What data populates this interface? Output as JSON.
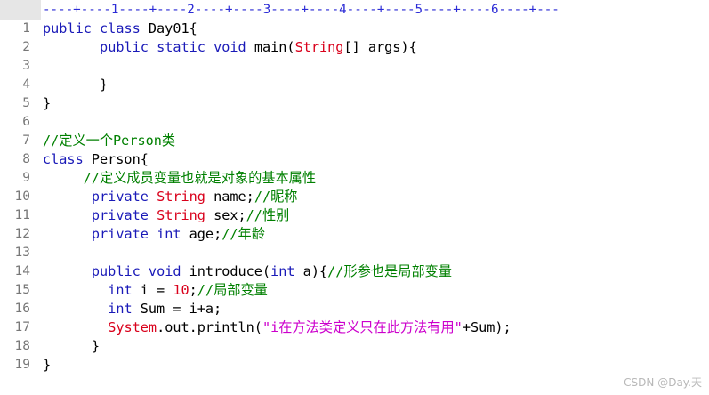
{
  "ruler": {
    "text": "----+----1----+----2----+----3----+----4----+----5----+----6----+---"
  },
  "colors": {
    "keyword": "#1a1ab8",
    "type": "#d9001b",
    "comment": "#008000",
    "string": "#cc00cc",
    "plain": "#000000",
    "line_number": "#777777"
  },
  "lines": [
    {
      "n": "1",
      "indent": 0,
      "tokens": [
        [
          "kw",
          "public"
        ],
        [
          "pl",
          " "
        ],
        [
          "kw",
          "class"
        ],
        [
          "pl",
          " Day01{"
        ]
      ]
    },
    {
      "n": "2",
      "indent": 7,
      "tokens": [
        [
          "kw",
          "public"
        ],
        [
          "pl",
          " "
        ],
        [
          "kw",
          "static"
        ],
        [
          "pl",
          " "
        ],
        [
          "kw",
          "void"
        ],
        [
          "pl",
          " main("
        ],
        [
          "ty",
          "String"
        ],
        [
          "pl",
          "[] args){"
        ]
      ]
    },
    {
      "n": "3",
      "indent": 0,
      "tokens": []
    },
    {
      "n": "4",
      "indent": 7,
      "tokens": [
        [
          "pl",
          "}"
        ]
      ]
    },
    {
      "n": "5",
      "indent": 0,
      "tokens": [
        [
          "pl",
          "}"
        ]
      ]
    },
    {
      "n": "6",
      "indent": 0,
      "tokens": []
    },
    {
      "n": "7",
      "indent": 0,
      "tokens": [
        [
          "cm",
          "//定义一个Person类"
        ]
      ]
    },
    {
      "n": "8",
      "indent": 0,
      "tokens": [
        [
          "kw",
          "class"
        ],
        [
          "pl",
          " Person{"
        ]
      ]
    },
    {
      "n": "9",
      "indent": 5,
      "tokens": [
        [
          "cm",
          "//定义成员变量也就是对象的基本属性"
        ]
      ]
    },
    {
      "n": "10",
      "indent": 6,
      "tokens": [
        [
          "kw",
          "private"
        ],
        [
          "pl",
          " "
        ],
        [
          "ty",
          "String"
        ],
        [
          "pl",
          " name;"
        ],
        [
          "cm",
          "//昵称"
        ]
      ]
    },
    {
      "n": "11",
      "indent": 6,
      "tokens": [
        [
          "kw",
          "private"
        ],
        [
          "pl",
          " "
        ],
        [
          "ty",
          "String"
        ],
        [
          "pl",
          " sex;"
        ],
        [
          "cm",
          "//性别"
        ]
      ]
    },
    {
      "n": "12",
      "indent": 6,
      "tokens": [
        [
          "kw",
          "private"
        ],
        [
          "pl",
          " "
        ],
        [
          "kw",
          "int"
        ],
        [
          "pl",
          " age;"
        ],
        [
          "cm",
          "//年龄"
        ]
      ]
    },
    {
      "n": "13",
      "indent": 0,
      "tokens": []
    },
    {
      "n": "14",
      "indent": 6,
      "tokens": [
        [
          "kw",
          "public"
        ],
        [
          "pl",
          " "
        ],
        [
          "kw",
          "void"
        ],
        [
          "pl",
          " introduce("
        ],
        [
          "kw",
          "int"
        ],
        [
          "pl",
          " a){"
        ],
        [
          "cm",
          "//形参也是局部变量"
        ]
      ]
    },
    {
      "n": "15",
      "indent": 8,
      "tokens": [
        [
          "kw",
          "int"
        ],
        [
          "pl",
          " i = "
        ],
        [
          "ty",
          "10"
        ],
        [
          "pl",
          ";"
        ],
        [
          "cm",
          "//局部变量"
        ]
      ]
    },
    {
      "n": "16",
      "indent": 8,
      "tokens": [
        [
          "kw",
          "int"
        ],
        [
          "pl",
          " Sum = i+a;"
        ]
      ]
    },
    {
      "n": "17",
      "indent": 8,
      "tokens": [
        [
          "ty",
          "System"
        ],
        [
          "pl",
          ".out.println("
        ],
        [
          "st",
          "\"i在方法类定义只在此方法有用\""
        ],
        [
          "pl",
          "+Sum);"
        ]
      ]
    },
    {
      "n": "18",
      "indent": 6,
      "tokens": [
        [
          "pl",
          "}"
        ]
      ]
    },
    {
      "n": "19",
      "indent": 0,
      "tokens": [
        [
          "pl",
          "}"
        ]
      ]
    }
  ],
  "watermark": "CSDN @Day.天"
}
